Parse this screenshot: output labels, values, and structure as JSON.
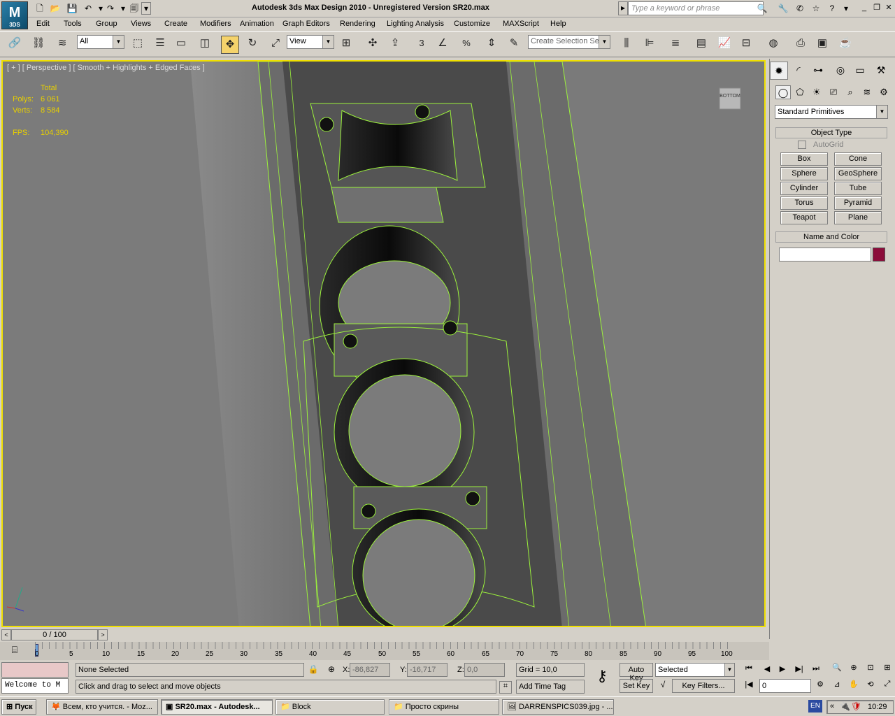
{
  "app": {
    "logo_text": "M",
    "logo_sub": "3DS",
    "title": "Autodesk 3ds Max Design 2010  - Unregistered Version    SR20.max",
    "search_placeholder": "Type a keyword or phrase"
  },
  "menu": [
    "Edit",
    "Tools",
    "Group",
    "Views",
    "Create",
    "Modifiers",
    "Animation",
    "Graph Editors",
    "Rendering",
    "Lighting Analysis",
    "Customize",
    "MAXScript",
    "Help"
  ],
  "toolbar": {
    "selection_filter": "All",
    "reference_coord": "View",
    "named_selection_placeholder": "Create Selection Se",
    "snap_label": "3",
    "percent_label": "%"
  },
  "viewport": {
    "label": "[ + ] [ Perspective ] [ Smooth + Highlights + Edged Faces ]",
    "stats": {
      "header": "Total",
      "polys_label": "Polys:",
      "polys": "6 061",
      "verts_label": "Verts:",
      "verts": "8 584",
      "fps_label": "FPS:",
      "fps": "104,390"
    },
    "viewcube_label": "BOTTOM"
  },
  "command_panel": {
    "dropdown": "Standard Primitives",
    "object_type_title": "Object Type",
    "autogrid_label": "AutoGrid",
    "primitives": [
      "Box",
      "Cone",
      "Sphere",
      "GeoSphere",
      "Cylinder",
      "Tube",
      "Torus",
      "Pyramid",
      "Teapot",
      "Plane"
    ],
    "name_color_title": "Name and Color",
    "object_name": "",
    "object_color": "#8b0d3a"
  },
  "timeline": {
    "frame_display": "0 / 100",
    "ticks": [
      "0",
      "5",
      "10",
      "15",
      "20",
      "25",
      "30",
      "35",
      "40",
      "45",
      "50",
      "55",
      "60",
      "65",
      "70",
      "75",
      "80",
      "85",
      "90",
      "95",
      "100"
    ]
  },
  "status": {
    "maxscript_listener": "Welcome to M",
    "selection": "None Selected",
    "prompt": "Click and drag to select and move objects",
    "x_label": "X:",
    "x": "-86,827",
    "y_label": "Y:",
    "y": "-16,717",
    "z_label": "Z:",
    "z": "0,0",
    "grid": "Grid = 10,0",
    "add_time_tag": "Add Time Tag",
    "auto_key": "Auto Key",
    "set_key": "Set Key",
    "key_mode": "Selected",
    "key_filters": "Key Filters...",
    "current_frame": "0"
  },
  "taskbar": {
    "start": "Пуск",
    "tasks": [
      "Всем, кто учится. - Moz...",
      "SR20.max - Autodesk...",
      "Block",
      "Просто скрины",
      "DARRENSPICS039.jpg - ..."
    ],
    "lang": "EN",
    "clock": "10:29"
  }
}
